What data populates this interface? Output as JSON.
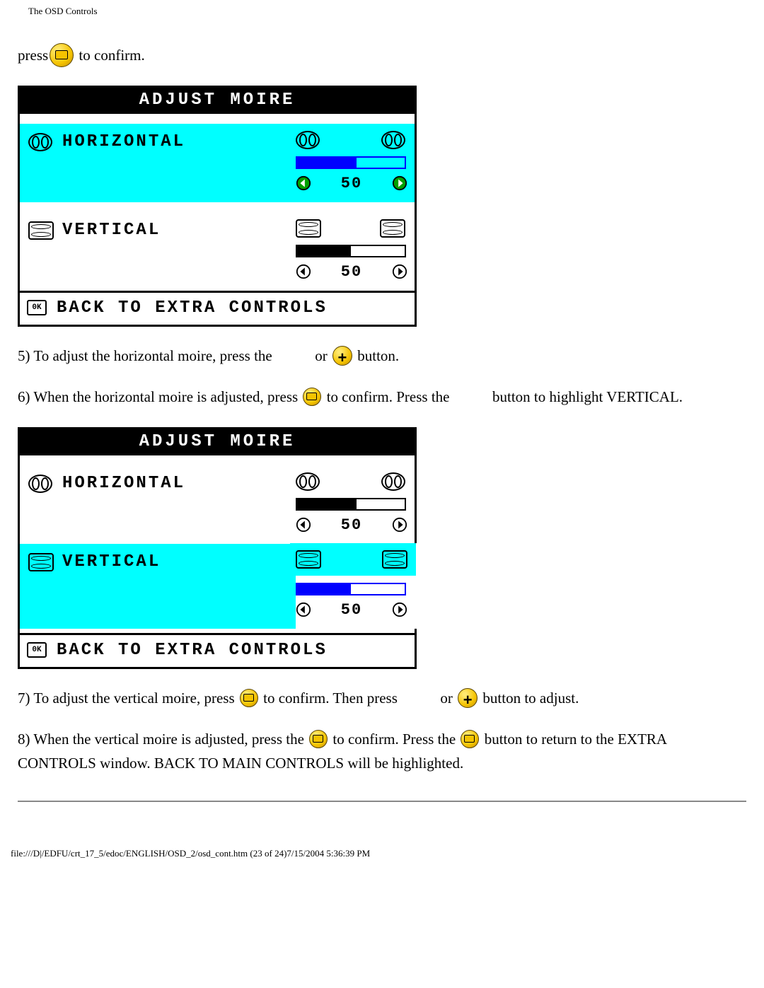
{
  "header": "The OSD Controls",
  "intro": {
    "press": "press",
    "to_confirm": " to confirm."
  },
  "osd1": {
    "title": "ADJUST MOIRE",
    "horizontal": "HORIZONTAL",
    "vertical": "VERTICAL",
    "h_value": "50",
    "v_value": "50",
    "back": "BACK TO EXTRA CONTROLS",
    "ok_glyph": "0K"
  },
  "step5": {
    "a": "5) To adjust the horizontal moire, press the ",
    "b": " or ",
    "c": " button."
  },
  "step6": {
    "a": "6) When the horizontal moire is adjusted, press ",
    "b": " to confirm. Press the ",
    "c": " button to highlight VERTICAL."
  },
  "osd2": {
    "title": "ADJUST MOIRE",
    "horizontal": "HORIZONTAL",
    "vertical": "VERTICAL",
    "h_value": "50",
    "v_value": "50",
    "back": "BACK TO EXTRA CONTROLS",
    "ok_glyph": "0K"
  },
  "step7": {
    "a": "7) To adjust the vertical moire, press ",
    "b": " to confirm. Then press ",
    "c": " or ",
    "d": " button to adjust."
  },
  "step8": {
    "a": "8) When the vertical moire is adjusted, press the ",
    "b": " to confirm. Press the ",
    "c": " button to return to the EXTRA CONTROLS window. BACK TO MAIN CONTROLS will be highlighted."
  },
  "footer": "file:///D|/EDFU/crt_17_5/edoc/ENGLISH/OSD_2/osd_cont.htm (23 of 24)7/15/2004 5:36:39 PM"
}
